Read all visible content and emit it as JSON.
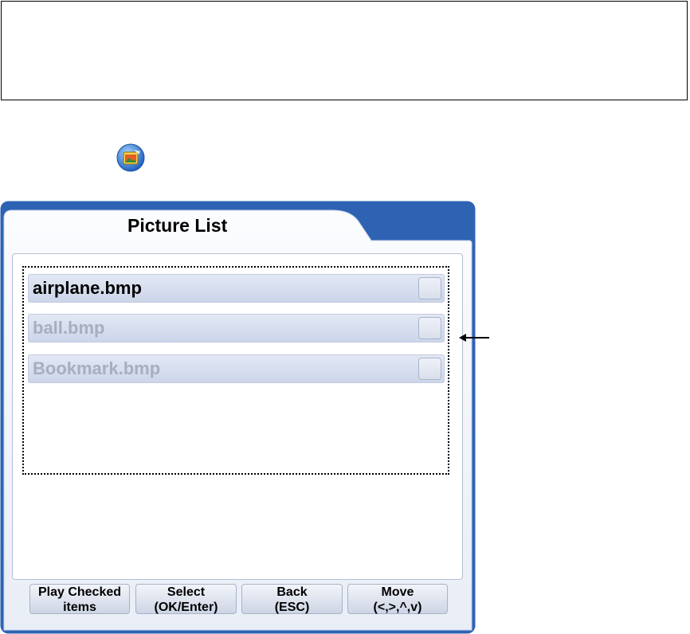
{
  "panel": {
    "title": "Picture List"
  },
  "list": {
    "items": [
      {
        "label": "airplane.bmp",
        "selected": true,
        "checked": false
      },
      {
        "label": "ball.bmp",
        "selected": false,
        "checked": false
      },
      {
        "label": "Bookmark.bmp",
        "selected": false,
        "checked": false
      }
    ]
  },
  "buttons": [
    {
      "line1": "Play Checked",
      "line2": "items"
    },
    {
      "line1": "Select",
      "line2": "(OK/Enter)"
    },
    {
      "line1": "Back",
      "line2": "(ESC)"
    },
    {
      "line1": "Move",
      "line2": "(<,>,^,v)"
    }
  ],
  "colors": {
    "accent_blue": "#2e63b4",
    "item_text_dim": "#a6afbf"
  },
  "icons": {
    "app": "picture-folder-icon",
    "pointer": "left-arrow-icon"
  }
}
